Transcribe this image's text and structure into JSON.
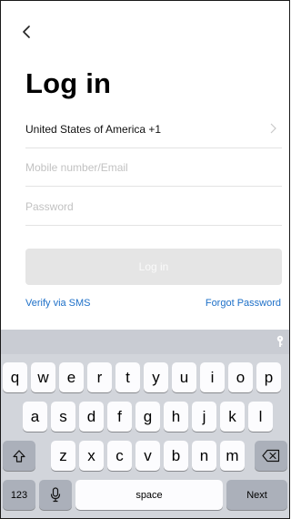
{
  "nav": {
    "back_icon": "chevron-left-icon"
  },
  "page": {
    "title": "Log in"
  },
  "form": {
    "country": "United States of America +1",
    "mobile_placeholder": "Mobile number/Email",
    "password_placeholder": "Password",
    "login_label": "Log in"
  },
  "links": {
    "verify_sms": "Verify via SMS",
    "forgot_password": "Forgot Password"
  },
  "keyboard": {
    "row1": [
      "q",
      "w",
      "e",
      "r",
      "t",
      "y",
      "u",
      "i",
      "o",
      "p"
    ],
    "row2": [
      "a",
      "s",
      "d",
      "f",
      "g",
      "h",
      "j",
      "k",
      "l"
    ],
    "row3": [
      "z",
      "x",
      "c",
      "v",
      "b",
      "n",
      "m"
    ],
    "numbers_label": "123",
    "space_label": "space",
    "next_label": "Next"
  },
  "colors": {
    "link": "#1e70c8",
    "button_disabled": "#e5e5e5",
    "keyboard_bg": "#d2d5db"
  }
}
